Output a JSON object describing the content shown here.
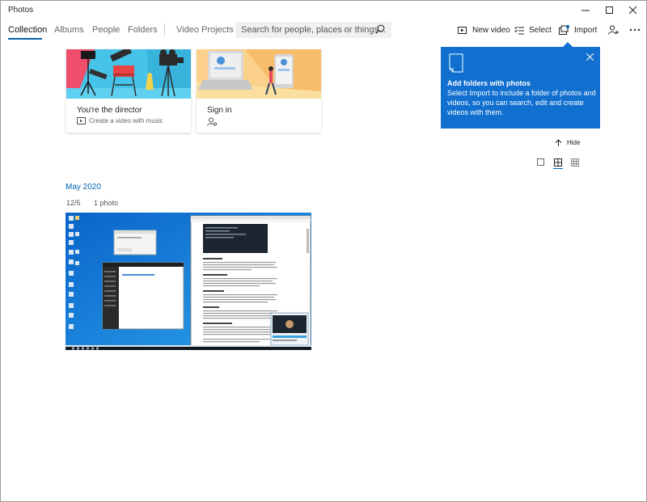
{
  "app": {
    "title": "Photos"
  },
  "nav": {
    "tabs": [
      {
        "label": "Collection",
        "active": true
      },
      {
        "label": "Albums",
        "active": false
      },
      {
        "label": "People",
        "active": false
      },
      {
        "label": "Folders",
        "active": false
      },
      {
        "label": "Video Projects",
        "active": false
      }
    ],
    "search_placeholder": "Search for people, places or things...",
    "commands": {
      "new_video": "New video",
      "select": "Select",
      "import": "Import"
    }
  },
  "cards": [
    {
      "title": "You're the director",
      "subtitle": "Create a video with music",
      "icon": "video-icon"
    },
    {
      "title": "Sign in",
      "subtitle": "",
      "icon": "person-icon"
    }
  ],
  "flyout": {
    "title": "Add folders with photos",
    "body": "Select Import to include a folder of photos and videos, so you can search, edit and create videos with them."
  },
  "controls": {
    "hide_label": "Hide"
  },
  "gallery": {
    "month": "May 2020",
    "date": "12/5",
    "count": "1 photo"
  },
  "colors": {
    "accent": "#0063b1",
    "flyout_bg": "#1170cf"
  }
}
